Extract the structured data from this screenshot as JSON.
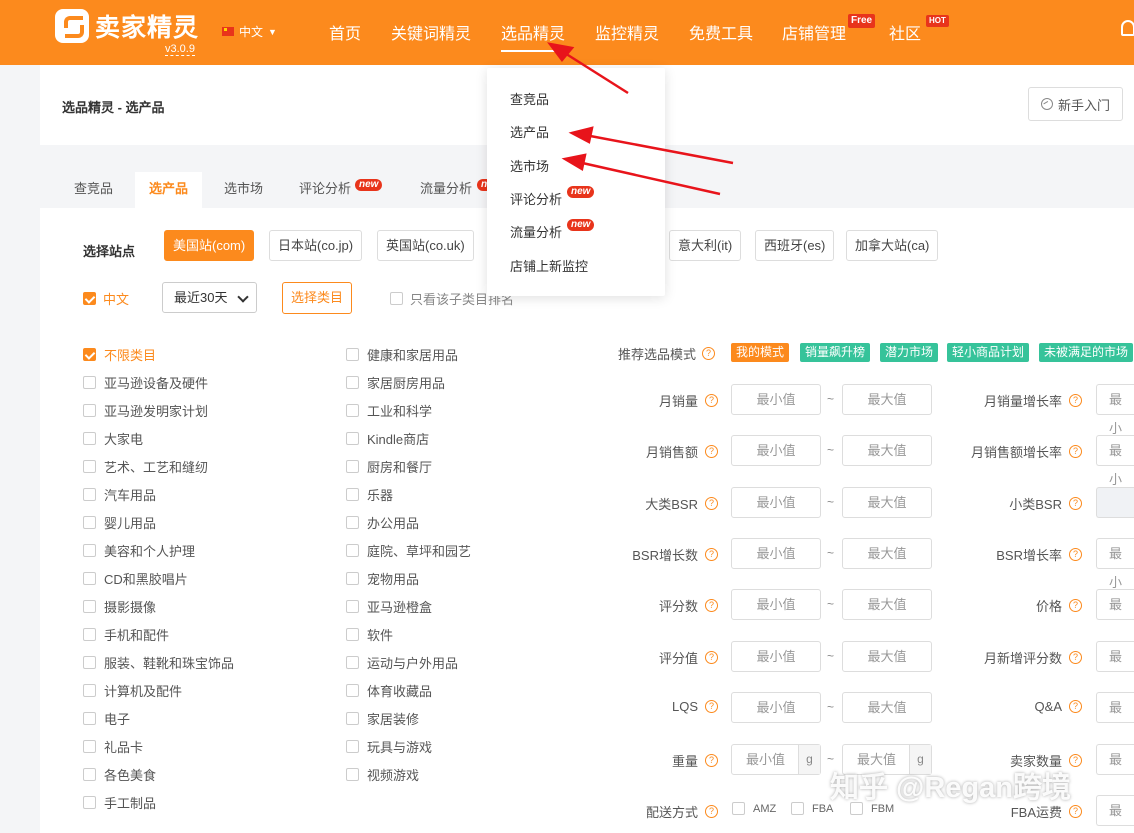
{
  "app": {
    "brand": "卖家精灵",
    "version": "v3.0.9",
    "language": "中文"
  },
  "nav": [
    {
      "label": "首页"
    },
    {
      "label": "关键词精灵"
    },
    {
      "label": "选品精灵",
      "active": true
    },
    {
      "label": "监控精灵"
    },
    {
      "label": "免费工具"
    },
    {
      "label": "店铺管理",
      "badge": "Free"
    },
    {
      "label": "社区",
      "badge": "HOT"
    }
  ],
  "header": {
    "breadcrumb": "选品精灵 - 选产品",
    "guide_label": "新手入门"
  },
  "tabs": [
    {
      "label": "查竞品"
    },
    {
      "label": "选产品",
      "active": true
    },
    {
      "label": "选市场"
    },
    {
      "label": "评论分析",
      "badge": "new"
    },
    {
      "label": "流量分析",
      "badge": "n"
    }
  ],
  "dropdown": {
    "items": [
      {
        "label": "查竞品"
      },
      {
        "label": "选产品"
      },
      {
        "label": "选市场"
      },
      {
        "label": "评论分析",
        "badge": "new"
      },
      {
        "label": "流量分析",
        "badge": "new"
      },
      {
        "label": "店铺上新监控"
      }
    ]
  },
  "site": {
    "label": "选择站点",
    "options": [
      {
        "label": "美国站(com)",
        "active": true
      },
      {
        "label": "日本站(co.jp)"
      },
      {
        "label": "英国站(co.uk)"
      },
      {
        "label": "意大利(it)"
      },
      {
        "label": "西班牙(es)"
      },
      {
        "label": "加拿大站(ca)"
      }
    ]
  },
  "filters_row": {
    "lang_label": "中文",
    "period": "最近30天",
    "category_button": "选择类目",
    "only_sub_label": "只看该子类目排名"
  },
  "categories": {
    "col1": [
      "不限类目",
      "亚马逊设备及硬件",
      "亚马逊发明家计划",
      "大家电",
      "艺术、工艺和缝纫",
      "汽车用品",
      "婴儿用品",
      "美容和个人护理",
      "CD和黑胶唱片",
      "摄影摄像",
      "手机和配件",
      "服装、鞋靴和珠宝饰品",
      "计算机及配件",
      "电子",
      "礼品卡",
      "各色美食",
      "手工制品"
    ],
    "col2": [
      "健康和家居用品",
      "家居厨房用品",
      "工业和科学",
      "Kindle商店",
      "厨房和餐厅",
      "乐器",
      "办公用品",
      "庭院、草坪和园艺",
      "宠物用品",
      "亚马逊橙盒",
      "软件",
      "运动与户外用品",
      "体育收藏品",
      "家居装修",
      "玩具与游戏",
      "视频游戏"
    ]
  },
  "mode": {
    "label": "推荐选品模式",
    "tags": [
      {
        "label": "我的模式",
        "color": "#fc8a1d"
      },
      {
        "label": "销量飙升榜",
        "color": "#36c39a"
      },
      {
        "label": "潜力市场",
        "color": "#36c39a"
      },
      {
        "label": "轻小商品计划",
        "color": "#36c39a"
      },
      {
        "label": "未被满足的市场",
        "color": "#36c39a"
      }
    ]
  },
  "fields_left": [
    {
      "label": "月销量"
    },
    {
      "label": "月销售额"
    },
    {
      "label": "大类BSR"
    },
    {
      "label": "BSR增长数"
    },
    {
      "label": "评分数"
    },
    {
      "label": "评分值"
    },
    {
      "label": "LQS"
    },
    {
      "label": "重量",
      "unit": "g"
    }
  ],
  "fields_right": [
    {
      "label": "月销量增长率",
      "placeholder": "最小"
    },
    {
      "label": "月销售额增长率",
      "placeholder": "最小"
    },
    {
      "label": "小类BSR",
      "placeholder": ""
    },
    {
      "label": "BSR增长率",
      "placeholder": "最小"
    },
    {
      "label": "价格",
      "placeholder": "最"
    },
    {
      "label": "月新增评分数",
      "placeholder": "最"
    },
    {
      "label": "Q&A",
      "placeholder": "最"
    },
    {
      "label": "卖家数量",
      "placeholder": "最"
    },
    {
      "label": "FBA运费",
      "placeholder": "最"
    }
  ],
  "placeholders": {
    "min": "最小值",
    "max": "最大值"
  },
  "shipping": {
    "label": "配送方式",
    "options": [
      "AMZ",
      "FBA",
      "FBM"
    ]
  },
  "watermark": "知乎 @Regan跨境",
  "colors": {
    "brand": "#fc8a1d",
    "badge_red": "#e8341b",
    "tag_green": "#36c39a",
    "arrow_red": "#e8141b"
  }
}
